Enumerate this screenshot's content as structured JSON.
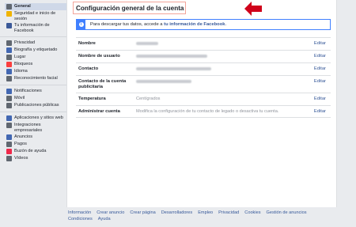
{
  "sidebar": {
    "groups": [
      {
        "items": [
          {
            "label": "General",
            "icon": "gear-icon",
            "color": "#606770",
            "active": true
          },
          {
            "label": "Seguridad e inicio de sesión",
            "icon": "shield-icon",
            "color": "#f0b400"
          },
          {
            "label": "Tu información de Facebook",
            "icon": "facebook-icon",
            "color": "#3b5998"
          }
        ]
      },
      {
        "items": [
          {
            "label": "Privacidad",
            "icon": "lock-icon",
            "color": "#606770"
          },
          {
            "label": "Biografía y etiquetado",
            "icon": "timeline-icon",
            "color": "#4267b2"
          },
          {
            "label": "Lugar",
            "icon": "location-pin-icon",
            "color": "#606770"
          },
          {
            "label": "Bloqueos",
            "icon": "block-icon",
            "color": "#fa3e3e"
          },
          {
            "label": "Idioma",
            "icon": "language-icon",
            "color": "#4267b2"
          },
          {
            "label": "Reconocimiento facial",
            "icon": "face-icon",
            "color": "#606770"
          }
        ]
      },
      {
        "items": [
          {
            "label": "Notificaciones",
            "icon": "globe-icon",
            "color": "#4267b2"
          },
          {
            "label": "Móvil",
            "icon": "mobile-icon",
            "color": "#606770"
          },
          {
            "label": "Publicaciones públicas",
            "icon": "rss-icon",
            "color": "#606770"
          }
        ]
      },
      {
        "items": [
          {
            "label": "Aplicaciones y sitios web",
            "icon": "apps-icon",
            "color": "#4267b2"
          },
          {
            "label": "Integraciones empresariales",
            "icon": "business-icon",
            "color": "#606770"
          },
          {
            "label": "Anuncios",
            "icon": "ads-icon",
            "color": "#4267b2"
          },
          {
            "label": "Pagos",
            "icon": "card-icon",
            "color": "#606770"
          },
          {
            "label": "Buzón de ayuda",
            "icon": "help-inbox-icon",
            "color": "#f0284a"
          },
          {
            "label": "Vídeos",
            "icon": "video-icon",
            "color": "#606770"
          }
        ]
      }
    ]
  },
  "main": {
    "title": "Configuración general de la cuenta",
    "arrow_color": "#d0021b",
    "info": {
      "text": "Para descargar tus datos, accede a",
      "link": "tu información de Facebook",
      "suffix": "."
    },
    "rows": [
      {
        "label": "Nombre",
        "value": "",
        "blur_width": 28,
        "edit": "Editar",
        "tall": false
      },
      {
        "label": "Nombre de usuario",
        "value": "",
        "blur_width": 90,
        "edit": "Editar",
        "tall": false
      },
      {
        "label": "Contacto",
        "value": "",
        "blur_width": 95,
        "edit": "Editar",
        "tall": false
      },
      {
        "label": "Contacto de la cuenta publicitaria",
        "value": "",
        "blur_width": 70,
        "edit": "Editar",
        "tall": true
      },
      {
        "label": "Temperatura",
        "value": "Centígrados",
        "blur_width": 0,
        "edit": "Editar",
        "tall": false
      },
      {
        "label": "Administrar cuenta",
        "value": "Modifica la configuración de tu contacto de legado o desactiva tu cuenta.",
        "blur_width": 0,
        "edit": "Editar",
        "tall": false
      }
    ]
  },
  "footer": {
    "links": [
      "Información",
      "Crear anuncio",
      "Crear página",
      "Desarrolladores",
      "Empleo",
      "Privacidad",
      "Cookies",
      "Gestión de anuncios",
      "Condiciones",
      "Ayuda"
    ]
  }
}
